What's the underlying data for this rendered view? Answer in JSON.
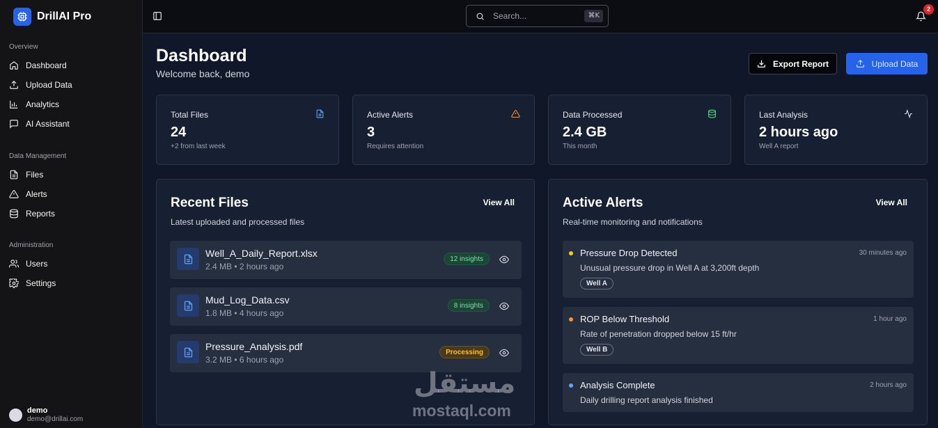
{
  "app": {
    "name": "DrillAI Pro"
  },
  "sidebar": {
    "sections": [
      {
        "heading": "Overview",
        "items": [
          {
            "label": "Dashboard",
            "icon": "home-icon"
          },
          {
            "label": "Upload Data",
            "icon": "upload-icon"
          },
          {
            "label": "Analytics",
            "icon": "bar-chart-icon"
          },
          {
            "label": "AI Assistant",
            "icon": "chat-icon"
          }
        ]
      },
      {
        "heading": "Data Management",
        "items": [
          {
            "label": "Files",
            "icon": "file-icon"
          },
          {
            "label": "Alerts",
            "icon": "alert-triangle-icon"
          },
          {
            "label": "Reports",
            "icon": "database-icon"
          }
        ]
      },
      {
        "heading": "Administration",
        "items": [
          {
            "label": "Users",
            "icon": "users-icon"
          },
          {
            "label": "Settings",
            "icon": "gear-icon"
          }
        ]
      }
    ],
    "user": {
      "name": "demo",
      "email": "demo@drillai.com"
    }
  },
  "topbar": {
    "search_placeholder": "Search...",
    "search_shortcut": "⌘K",
    "notification_count": "2"
  },
  "header": {
    "title": "Dashboard",
    "subtitle": "Welcome back, demo",
    "export_label": "Export Report",
    "upload_label": "Upload Data"
  },
  "stats": [
    {
      "label": "Total Files",
      "value": "24",
      "note": "+2 from last week",
      "icon": "file-text-icon",
      "color": "#60a5fa"
    },
    {
      "label": "Active Alerts",
      "value": "3",
      "note": "Requires attention",
      "icon": "alert-triangle-icon",
      "color": "#fb923c"
    },
    {
      "label": "Data Processed",
      "value": "2.4 GB",
      "note": "This month",
      "icon": "database-icon",
      "color": "#4ade80"
    },
    {
      "label": "Last Analysis",
      "value": "2 hours ago",
      "note": "Well A report",
      "icon": "activity-icon",
      "color": "#e5e7eb"
    }
  ],
  "recent_files": {
    "title": "Recent Files",
    "subtitle": "Latest uploaded and processed files",
    "view_all": "View All",
    "items": [
      {
        "name": "Well_A_Daily_Report.xlsx",
        "meta": "2.4 MB • 2 hours ago",
        "badge": "12 insights",
        "badge_type": "green"
      },
      {
        "name": "Mud_Log_Data.csv",
        "meta": "1.8 MB • 4 hours ago",
        "badge": "8 insights",
        "badge_type": "green"
      },
      {
        "name": "Pressure_Analysis.pdf",
        "meta": "3.2 MB • 6 hours ago",
        "badge": "Processing",
        "badge_type": "amber"
      }
    ]
  },
  "active_alerts": {
    "title": "Active Alerts",
    "subtitle": "Real-time monitoring and notifications",
    "view_all": "View All",
    "items": [
      {
        "title": "Pressure Drop Detected",
        "time": "30 minutes ago",
        "desc": "Unusual pressure drop in Well A at 3,200ft depth",
        "tag": "Well A",
        "dot_color": "#facc15"
      },
      {
        "title": "ROP Below Threshold",
        "time": "1 hour ago",
        "desc": "Rate of penetration dropped below 15 ft/hr",
        "tag": "Well B",
        "dot_color": "#fb923c"
      },
      {
        "title": "Analysis Complete",
        "time": "2 hours ago",
        "desc": "Daily drilling report analysis finished",
        "tag": "",
        "dot_color": "#60a5fa"
      }
    ]
  },
  "watermark": {
    "text": "mostaql.com",
    "arabic": "مستقل"
  }
}
